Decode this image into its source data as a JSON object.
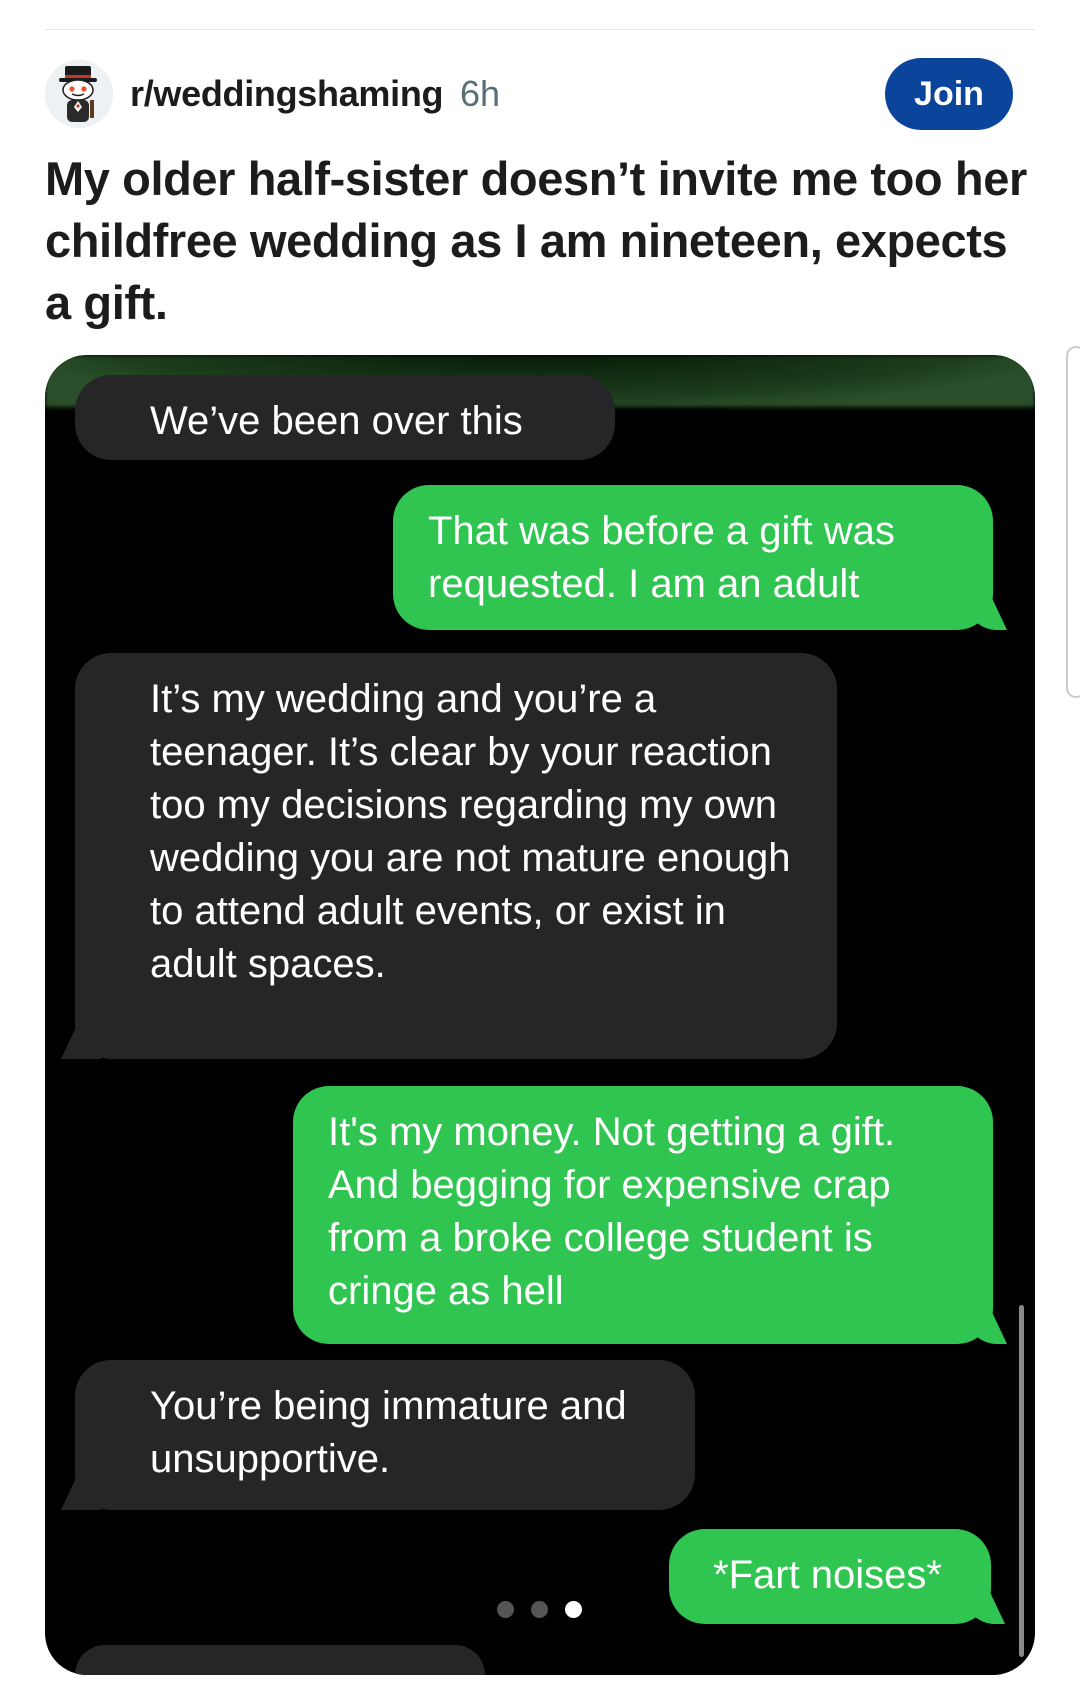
{
  "post": {
    "subreddit": "r/weddingshaming",
    "time": "6h",
    "join_label": "Join",
    "title": "My older half-sister doesn’t invite me too her childfree wedding as I am nineteen, expects a gift."
  },
  "icons": {
    "avatar": "snoo-top-hat-avatar"
  },
  "colors": {
    "join_button": "#0a449b",
    "sent_bubble": "#2fc550",
    "received_bubble": "#262628",
    "media_background": "#000000"
  },
  "conversation": {
    "messages": [
      {
        "direction": "received",
        "text": "We’ve been over this"
      },
      {
        "direction": "sent",
        "text": "That was before a gift was requested. I am an adult"
      },
      {
        "direction": "received",
        "text": "It’s my wedding and you’re a teenager. It’s clear by your reaction too my decisions regarding my own wedding you are not mature enough to attend adult events, or exist in adult spaces."
      },
      {
        "direction": "sent",
        "text": "It's my money. Not getting a gift. And begging for expensive crap from a broke college student is cringe as hell"
      },
      {
        "direction": "received",
        "text": "You’re being immature and unsupportive."
      },
      {
        "direction": "sent",
        "text": "*Fart noises*"
      }
    ]
  },
  "carousel": {
    "total": 3,
    "active": 3
  }
}
